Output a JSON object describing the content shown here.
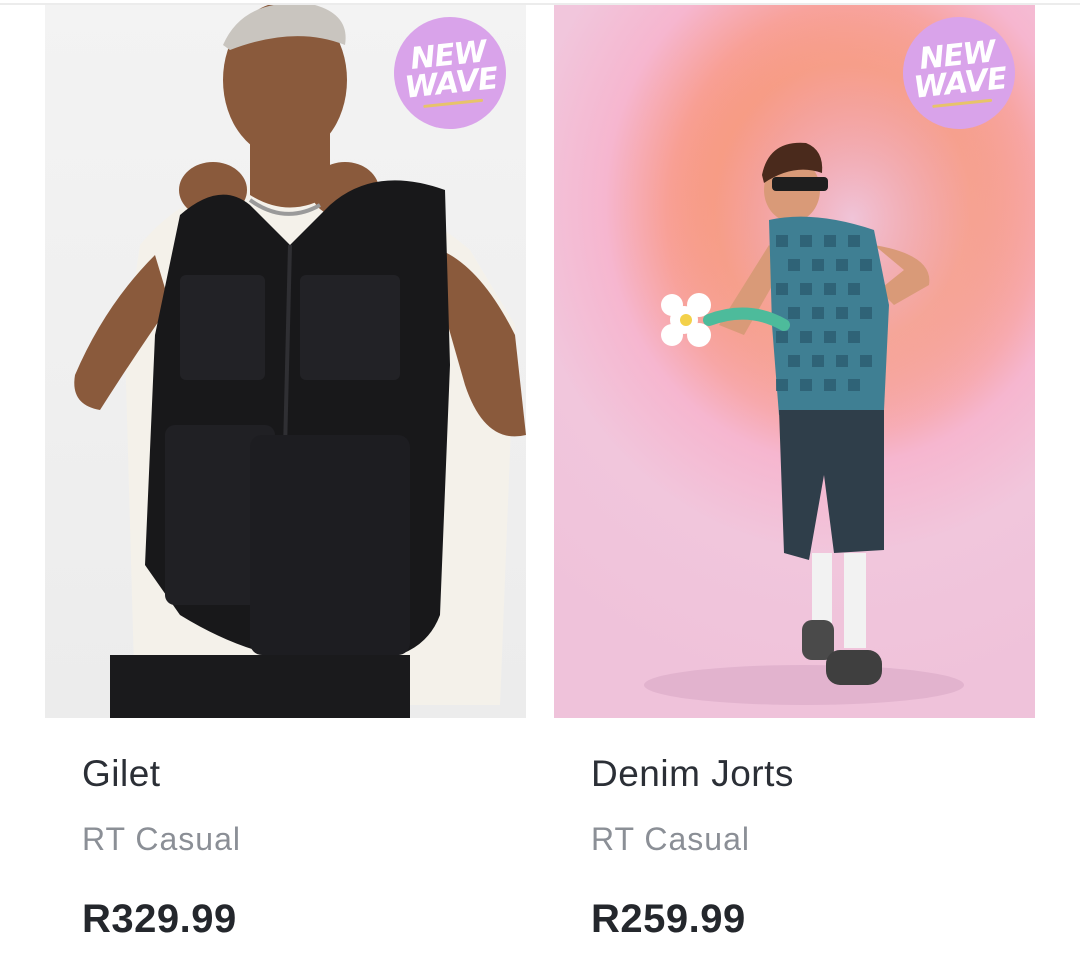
{
  "products": [
    {
      "name": "Gilet",
      "brand": "RT Casual",
      "price": "R329.99",
      "badge": {
        "line1": "NEW",
        "line2": "WAVE",
        "color": "#d9a3ea"
      }
    },
    {
      "name": "Denim Jorts",
      "brand": "RT Casual",
      "price": "R259.99",
      "badge": {
        "line1": "NEW",
        "line2": "WAVE",
        "color": "#d9a3ea"
      }
    }
  ]
}
